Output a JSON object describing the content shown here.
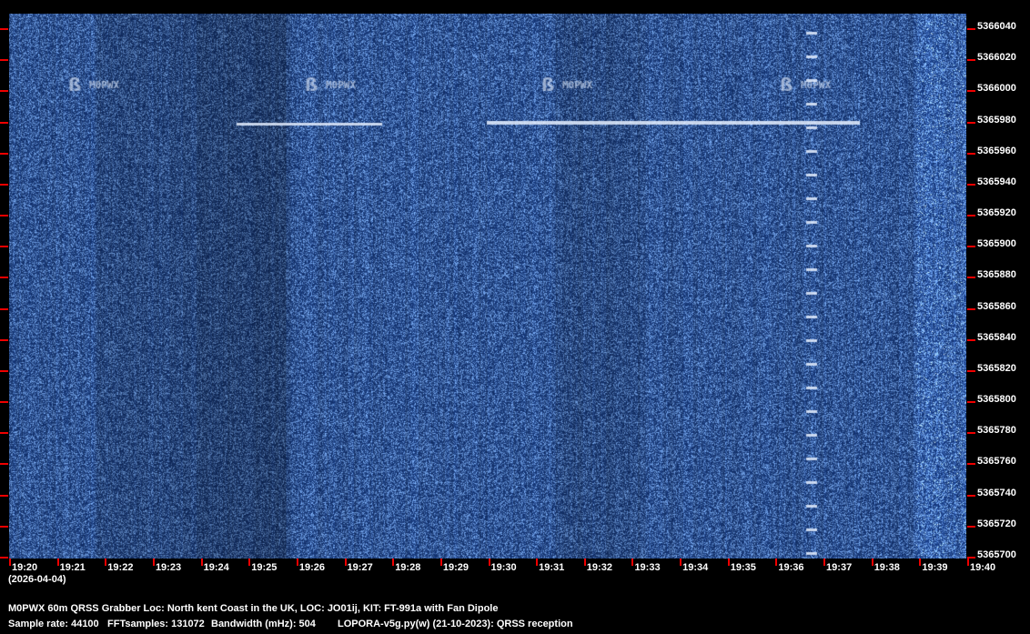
{
  "chart_data": {
    "type": "heatmap",
    "title": "M0PWX 60m QRSS Grabber spectrogram",
    "x_ticks": [
      "19:20",
      "19:21",
      "19:22",
      "19:23",
      "19:24",
      "19:25",
      "19:26",
      "19:27",
      "19:28",
      "19:29",
      "19:30",
      "19:31",
      "19:32",
      "19:33",
      "19:34",
      "19:35",
      "19:36",
      "19:37",
      "19:38",
      "19:39",
      "19:40"
    ],
    "y_ticks": [
      "5366040",
      "5366020",
      "5366000",
      "5365980",
      "5365960",
      "5365940",
      "5365920",
      "5365900",
      "5365880",
      "5365860",
      "5365840",
      "5365820",
      "5365800",
      "5365780",
      "5365760",
      "5365740",
      "5365720",
      "5365700"
    ],
    "ylim": [
      5365700,
      5366040
    ],
    "xlabel": "(2026-04-04)",
    "colors": {
      "background": "#10306a",
      "signal": "#e8f0ff",
      "tick": "#e00000"
    }
  },
  "footer": {
    "date": "(2026-04-04)",
    "line1": "M0PWX 60m QRSS Grabber Loc: North kent Coast in the UK, LOC: JO01ij, KIT: FT-991a with Fan Dipole",
    "sample_rate": "Sample rate: 44100",
    "fft": "FFTsamples: 131072",
    "bandwidth": "Bandwidth (mHz): 504",
    "software": "LOPORA-v5g.py(w) (21-10-2023): QRSS reception"
  }
}
